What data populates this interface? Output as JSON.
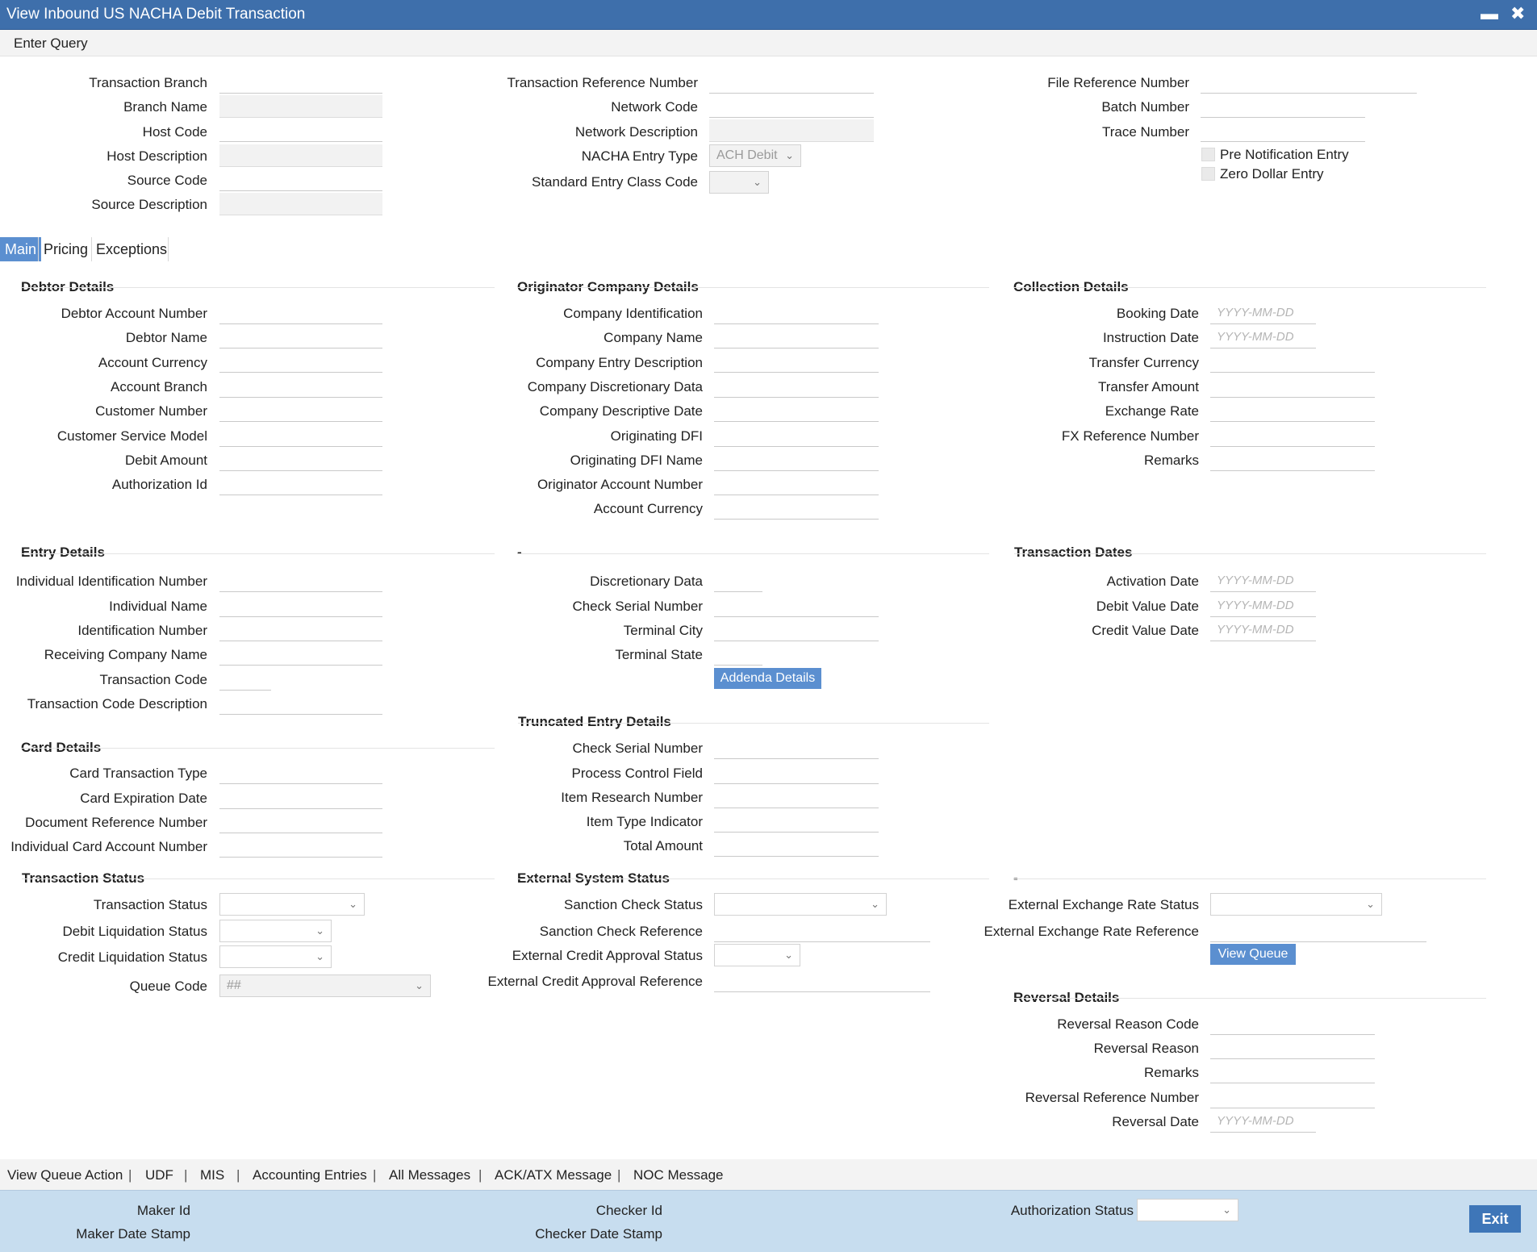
{
  "window": {
    "title": "View Inbound US NACHA Debit Transaction",
    "minimize": "▬",
    "close": "✖"
  },
  "toolbar": {
    "enter_query": "Enter Query"
  },
  "header": {
    "transaction_branch": "Transaction Branch",
    "branch_name": "Branch Name",
    "host_code": "Host Code",
    "host_description": "Host Description",
    "source_code": "Source Code",
    "source_description": "Source Description",
    "transaction_reference_number": "Transaction Reference Number",
    "network_code": "Network Code",
    "network_description": "Network Description",
    "nacha_entry_type": "NACHA Entry Type",
    "nacha_entry_type_value": "ACH Debit",
    "standard_entry_class_code": "Standard Entry Class Code",
    "file_reference_number": "File Reference Number",
    "batch_number": "Batch Number",
    "trace_number": "Trace Number",
    "pre_notification_entry": "Pre Notification Entry",
    "zero_dollar_entry": "Zero Dollar Entry"
  },
  "tabs": {
    "main": "Main",
    "pricing": "Pricing",
    "exceptions": "Exceptions"
  },
  "debtor": {
    "title": "Debtor Details",
    "account_number": "Debtor Account Number",
    "name": "Debtor Name",
    "account_currency": "Account Currency",
    "account_branch": "Account Branch",
    "customer_number": "Customer Number",
    "customer_service_model": "Customer Service Model",
    "debit_amount": "Debit Amount",
    "authorization_id": "Authorization Id"
  },
  "originator": {
    "title": "Originator Company Details",
    "company_identification": "Company Identification",
    "company_name": "Company Name",
    "company_entry_description": "Company Entry Description",
    "company_discretionary_data": "Company Discretionary Data",
    "company_descriptive_date": "Company Descriptive Date",
    "originating_dfi": "Originating DFI",
    "originating_dfi_name": "Originating DFI Name",
    "originator_account_number": "Originator Account Number",
    "account_currency": "Account Currency"
  },
  "collection": {
    "title": "Collection Details",
    "booking_date": "Booking Date",
    "instruction_date": "Instruction Date",
    "transfer_currency": "Transfer Currency",
    "transfer_amount": "Transfer Amount",
    "exchange_rate": "Exchange Rate",
    "fx_reference_number": "FX Reference Number",
    "remarks": "Remarks"
  },
  "date_placeholder": "YYYY-MM-DD",
  "entry": {
    "title": "Entry Details",
    "individual_identification_number": "Individual Identification Number",
    "individual_name": "Individual Name",
    "identification_number": "Identification Number",
    "receiving_company_name": "Receiving Company Name",
    "transaction_code": "Transaction Code",
    "transaction_code_description": "Transaction Code Description"
  },
  "misc": {
    "title": "-",
    "discretionary_data": "Discretionary Data",
    "check_serial_number": "Check Serial Number",
    "terminal_city": "Terminal City",
    "terminal_state": "Terminal State",
    "addenda_details": "Addenda Details"
  },
  "transaction_dates": {
    "title": "Transaction Dates",
    "activation_date": "Activation Date",
    "debit_value_date": "Debit Value Date",
    "credit_value_date": "Credit Value Date"
  },
  "card": {
    "title": "Card Details",
    "card_transaction_type": "Card Transaction Type",
    "card_expiration_date": "Card Expiration Date",
    "document_reference_number": "Document Reference Number",
    "individual_card_account_number": "Individual Card Account Number"
  },
  "truncated": {
    "title": "Truncated Entry Details",
    "check_serial_number": "Check Serial Number",
    "process_control_field": "Process Control Field",
    "item_research_number": "Item Research Number",
    "item_type_indicator": "Item Type Indicator",
    "total_amount": "Total Amount"
  },
  "status": {
    "title": "Transaction Status",
    "transaction_status": "Transaction Status",
    "debit_liquidation_status": "Debit Liquidation Status",
    "credit_liquidation_status": "Credit Liquidation Status",
    "queue_code": "Queue Code",
    "queue_code_value": "##"
  },
  "external": {
    "title": "External System Status",
    "sanction_check_status": "Sanction Check Status",
    "sanction_check_reference": "Sanction Check Reference",
    "external_credit_approval_status": "External Credit Approval Status",
    "external_credit_approval_reference": "External Credit Approval Reference"
  },
  "exrate": {
    "title": "-",
    "external_exchange_rate_status": "External Exchange Rate Status",
    "external_exchange_rate_reference": "External Exchange Rate Reference",
    "view_queue": "View Queue"
  },
  "reversal": {
    "title": "Reversal Details",
    "reversal_reason_code": "Reversal Reason Code",
    "reversal_reason": "Reversal Reason",
    "remarks": "Remarks",
    "reversal_reference_number": "Reversal Reference Number",
    "reversal_date": "Reversal Date"
  },
  "bottom_links": [
    "View Queue Action",
    "UDF",
    "MIS",
    "Accounting Entries",
    "All Messages",
    "ACK/ATX Message",
    "NOC Message"
  ],
  "footer": {
    "maker_id": "Maker Id",
    "maker_date_stamp": "Maker Date Stamp",
    "checker_id": "Checker Id",
    "checker_date_stamp": "Checker Date Stamp",
    "authorization_status": "Authorization Status",
    "exit": "Exit"
  }
}
